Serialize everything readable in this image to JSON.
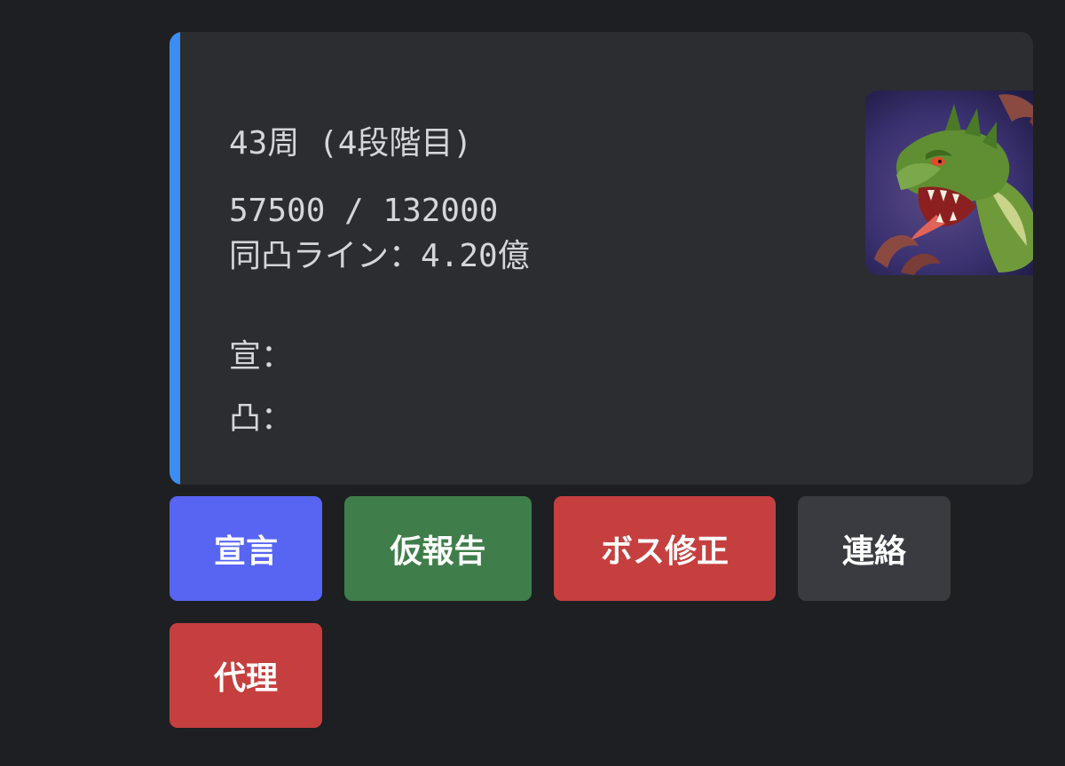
{
  "embed": {
    "accent_color": "#3b8ef0",
    "round_text": "43周 (4段階目)",
    "hp_text": "57500 / 132000",
    "attack_line_text": "同凸ライン：4.20億",
    "declared_text": "宣：",
    "attacking_text": "凸：",
    "thumbnail_icon": "green-dragon-boss-icon"
  },
  "buttons": {
    "declare": {
      "label": "宣言",
      "color": "#5865f2"
    },
    "temp_report": {
      "label": "仮報告",
      "color": "#3f7e4a"
    },
    "boss_fix": {
      "label": "ボス修正",
      "color": "#c63f3f"
    },
    "contact": {
      "label": "連絡",
      "color": "#393b41"
    },
    "proxy": {
      "label": "代理",
      "color": "#c63f3f"
    }
  }
}
